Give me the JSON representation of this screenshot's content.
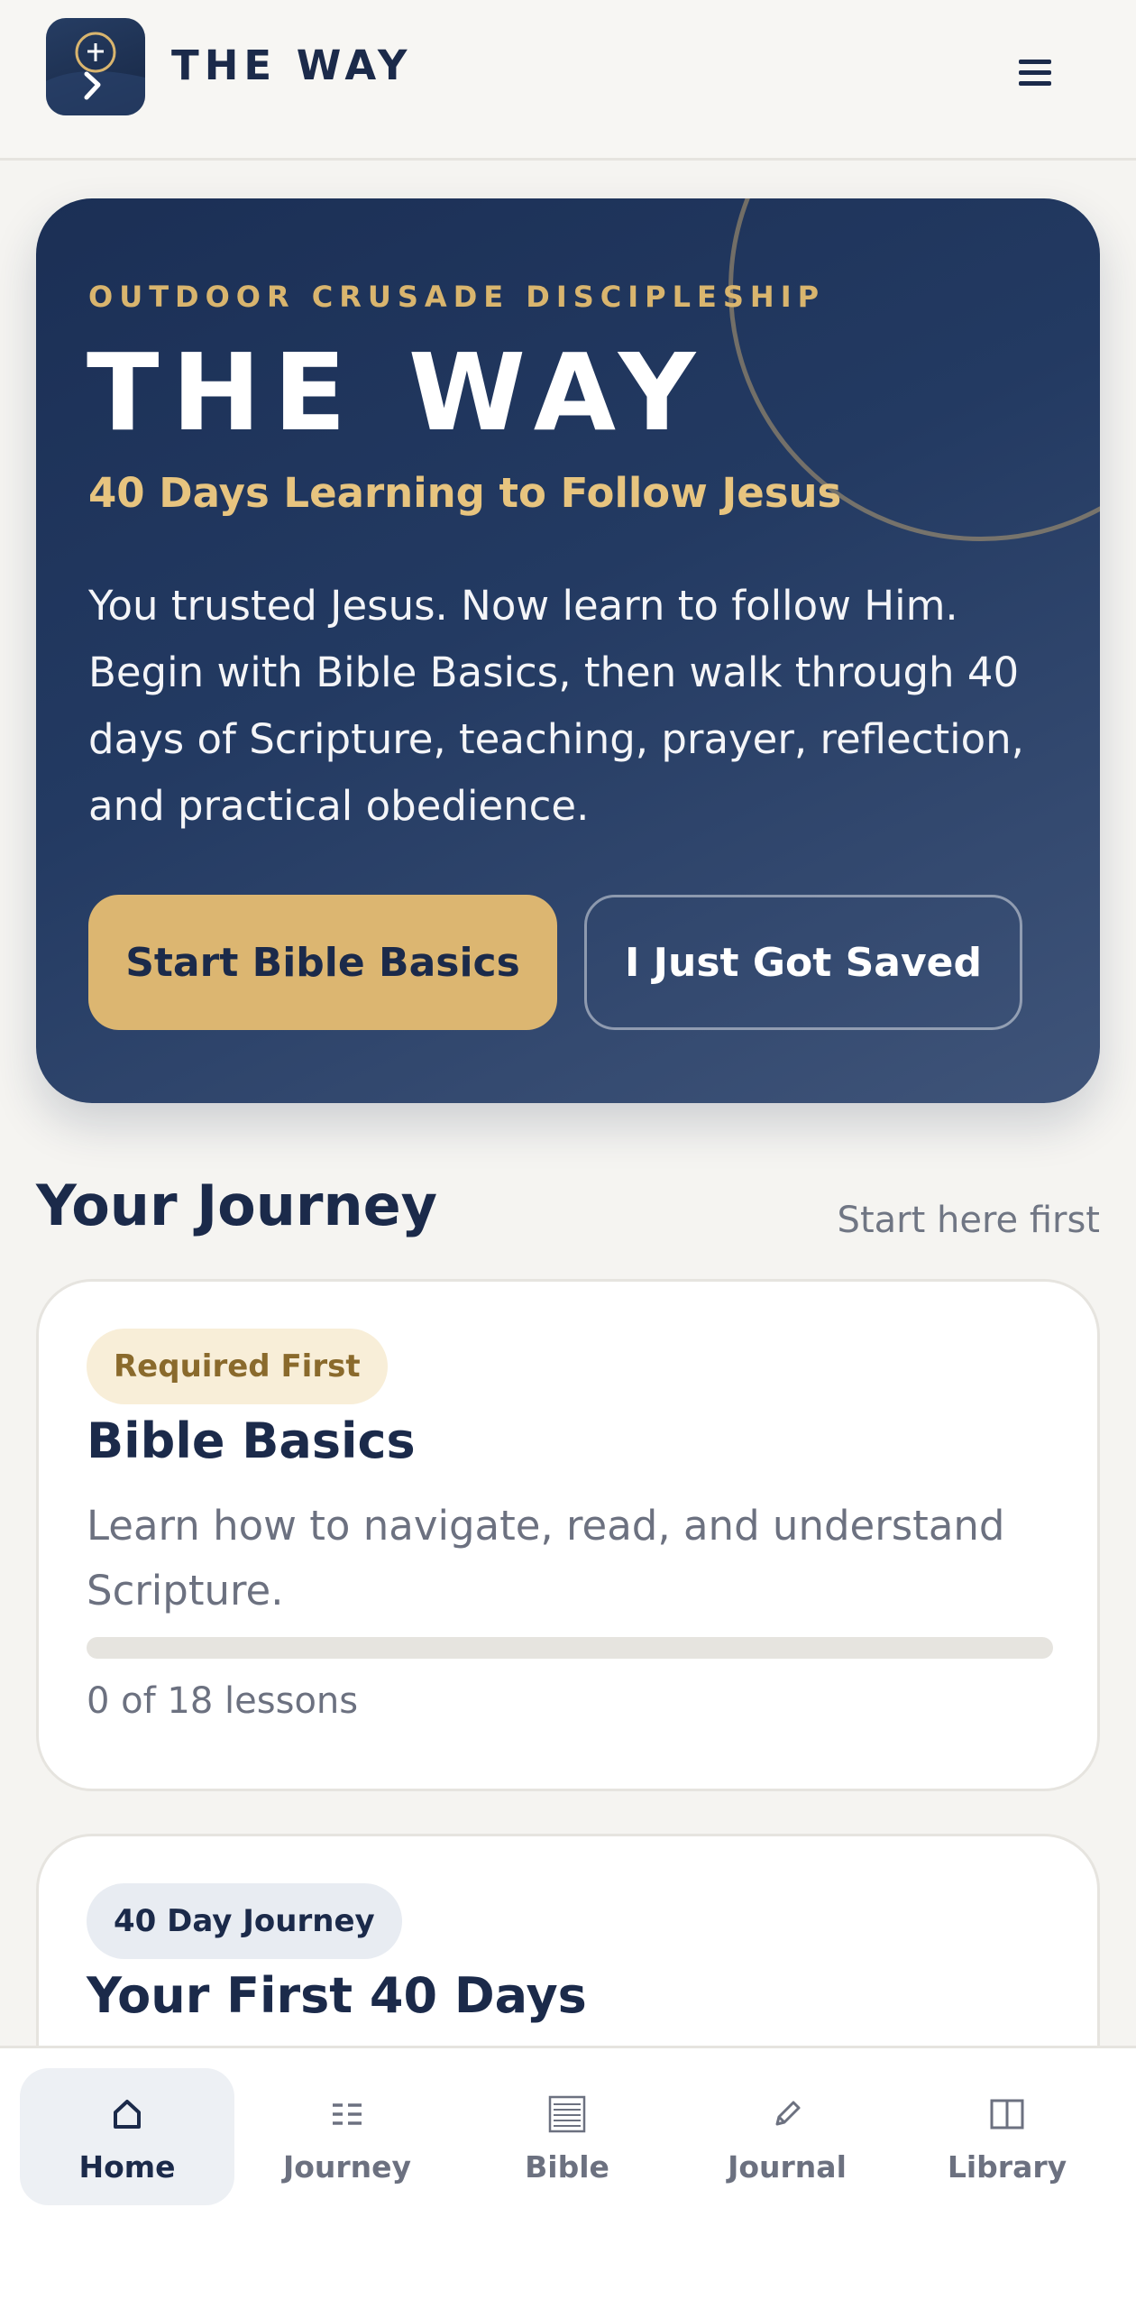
{
  "header": {
    "brand": "THE WAY",
    "logo_icon": "cross-path-logo-icon",
    "menu_icon": "hamburger-menu-icon"
  },
  "hero": {
    "eyebrow": "OUTDOOR CRUSADE DISCIPLESHIP",
    "title": "THE WAY",
    "subtitle": "40 Days Learning to Follow Jesus",
    "body": "You trusted Jesus. Now learn to follow Him. Begin with Bible Basics, then walk through 40 days of Scripture, teaching, prayer, reflection, and practical obedience.",
    "primary_button": "Start Bible Basics",
    "secondary_button": "I Just Got Saved"
  },
  "journey": {
    "title": "Your Journey",
    "link": "Start here first",
    "cards": [
      {
        "badge": "Required First",
        "title": "Bible Basics",
        "description": "Learn how to navigate, read, and understand Scripture.",
        "progress_text": "0 of 18 lessons",
        "progress_fraction": 0
      },
      {
        "badge": "40 Day Journey",
        "title": "Your First 40 Days"
      }
    ]
  },
  "nav": {
    "items": [
      {
        "label": "Home",
        "icon": "home-icon",
        "active": true
      },
      {
        "label": "Journey",
        "icon": "list-icon",
        "active": false
      },
      {
        "label": "Bible",
        "icon": "book-icon",
        "active": false
      },
      {
        "label": "Journal",
        "icon": "pencil-icon",
        "active": false
      },
      {
        "label": "Library",
        "icon": "open-book-icon",
        "active": false
      }
    ]
  },
  "colors": {
    "navy": "#1b2a4a",
    "gold": "#dcb671",
    "background": "#f5f4f1"
  }
}
